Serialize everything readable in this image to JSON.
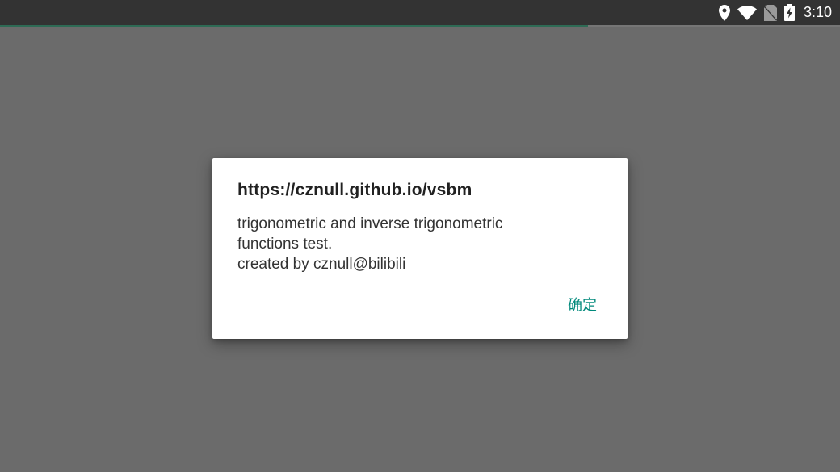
{
  "status_bar": {
    "time": "3:10",
    "icons": [
      "location-icon",
      "wifi-icon",
      "no-sim-icon",
      "battery-charging-icon"
    ]
  },
  "page_load_progress": 0.7,
  "dialog": {
    "title": "https://cznull.github.io/vsbm",
    "message_lines": [
      "trigonometric and inverse trigonometric",
      "functions test.",
      "created by cznull@bilibili"
    ],
    "ok_label": "确定"
  },
  "colors": {
    "scrim": "#6b6b6b",
    "status_bar": "#333333",
    "accent": "#00897b",
    "progress": "#2e6b55"
  }
}
